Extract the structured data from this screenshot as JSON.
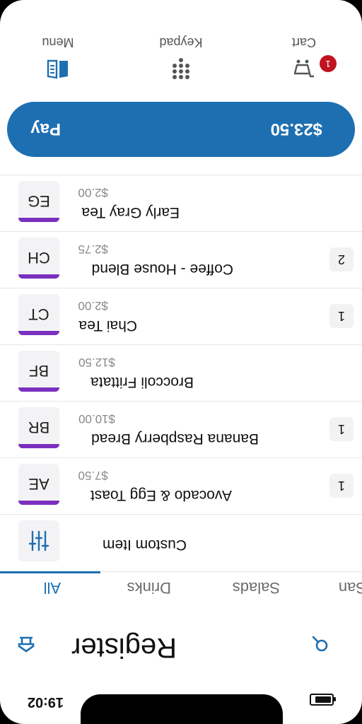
{
  "status": {
    "time": "19:02"
  },
  "header": {
    "title": "Register"
  },
  "tabs": [
    {
      "label": "All",
      "active": true
    },
    {
      "label": "Drinks",
      "active": false
    },
    {
      "label": "Salads",
      "active": false
    },
    {
      "label": "San",
      "active": false
    }
  ],
  "items": [
    {
      "code": "",
      "name": "Custom Item",
      "price": "",
      "qty": ""
    },
    {
      "code": "AE",
      "name": "Avocado & Egg Toast",
      "price": "$7.50",
      "qty": "1"
    },
    {
      "code": "BR",
      "name": "Banana Raspberry Bread",
      "price": "$10.00",
      "qty": "1"
    },
    {
      "code": "BF",
      "name": "Broccoli Frittata",
      "price": "$12.50",
      "qty": ""
    },
    {
      "code": "CT",
      "name": "Chai Tea",
      "price": "$2.00",
      "qty": "1"
    },
    {
      "code": "CH",
      "name": "Coffee - House Blend",
      "price": "$2.75",
      "qty": "2"
    },
    {
      "code": "EG",
      "name": "Early Gray Tea",
      "price": "$2.00",
      "qty": ""
    }
  ],
  "pay": {
    "label": "Pay",
    "amount": "$23.50"
  },
  "nav": [
    {
      "label": "Menu",
      "icon": "book-icon"
    },
    {
      "label": "Keypad",
      "icon": "keypad-icon"
    },
    {
      "label": "Cart",
      "icon": "cart-icon",
      "badge": "1"
    }
  ],
  "colors": {
    "accent": "#1d6fb1",
    "avatar_bar": "#7b2fbf",
    "badge": "#c1121f"
  }
}
